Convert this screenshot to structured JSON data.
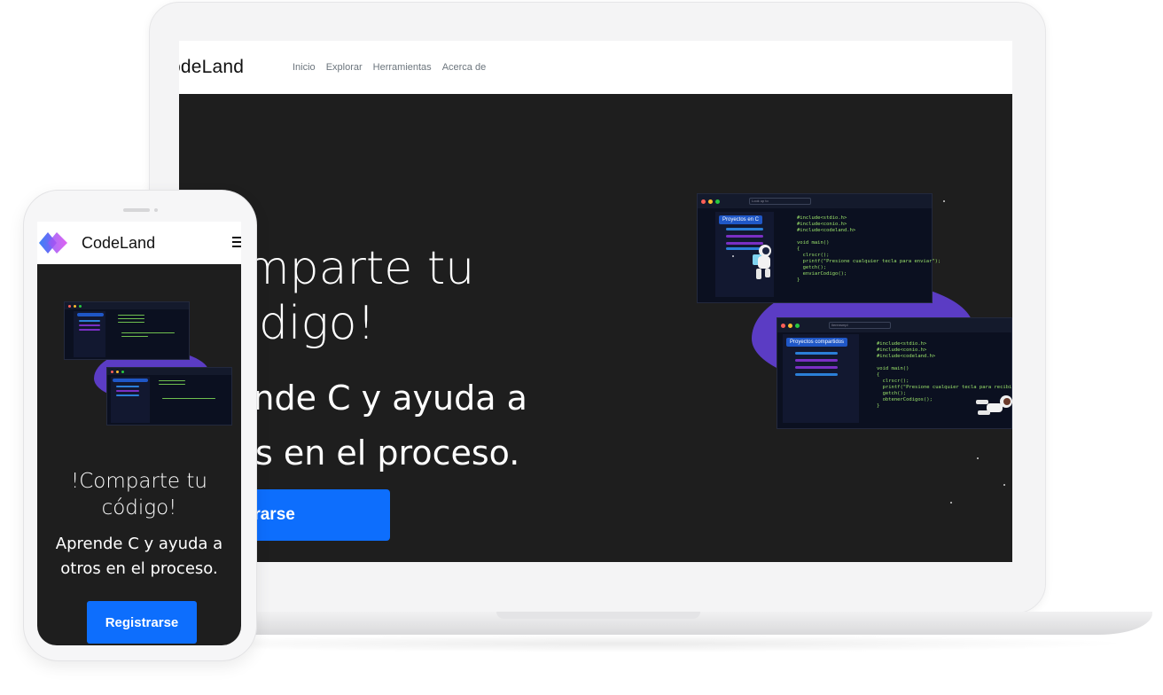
{
  "brand": "CodeLand",
  "brand_laptop_visible": "odeLand",
  "nav": [
    "Inicio",
    "Explorar",
    "Herramientas",
    "Acerca de"
  ],
  "hero": {
    "title": "!Comparte tu código!",
    "title_laptop_line1": "mparte tu",
    "title_laptop_line2": "digo!",
    "subtitle": "Aprende C y ayuda a otros en el proceso.",
    "subtitle_laptop_line1": "ende C y ayuda a",
    "subtitle_laptop_line2": "s en el proceso.",
    "phone_title_line1": "!Comparte tu",
    "phone_title_line2": "código!",
    "phone_subtitle_line1": "Aprende C y ayuda a",
    "phone_subtitle_line2": "otros en el proceso.",
    "cta": "Registrarse",
    "cta_laptop_visible": "egistrarse"
  },
  "illustration": {
    "window1": {
      "search": "Look up to",
      "tab": "Proyectos en C",
      "code": "#include<stdio.h>\n#include<conio.h>\n#include<codeland.h>\n\nvoid main()\n{\n  clrscr();\n  printf(\"Presione cualquier tecla para enviar\");\n  getch();\n  enviarCodigo();\n}"
    },
    "window2": {
      "search": "Ilerensmpi",
      "tab": "Proyectos compartidos",
      "code": "#include<stdio.h>\n#include<conio.h>\n#include<codeland.h>\n\nvoid main()\n{\n  clrscr();\n  printf(\"Presione cualquier tecla para recibir\");\n  getch();\n  obtenerCodigos();\n}"
    }
  },
  "colors": {
    "primary": "#0d6efd",
    "dark_bg": "#1e1e1e",
    "blob": "#5b3cc4",
    "code_green": "#9be36b",
    "tab_blue": "#1f57c7"
  }
}
